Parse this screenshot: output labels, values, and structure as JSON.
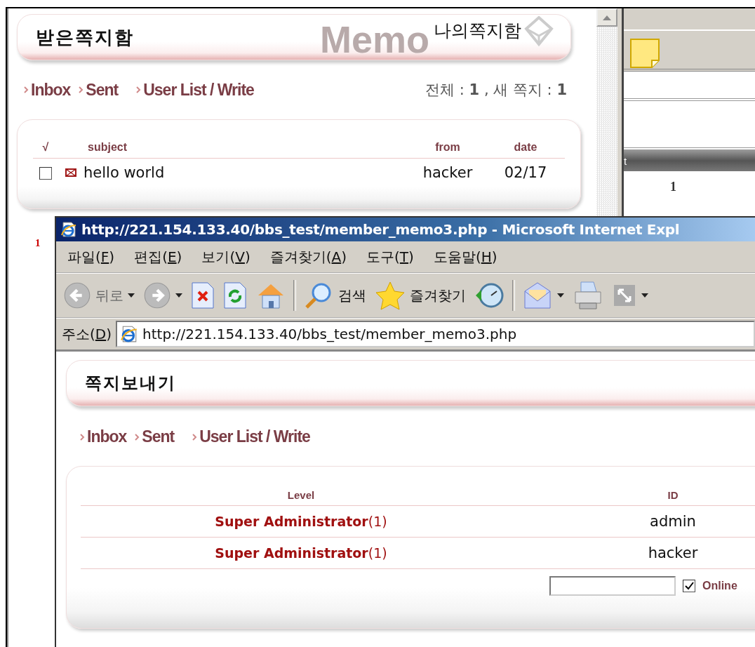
{
  "back_window": {
    "header": {
      "title": "받은쪽지함",
      "subtitle": "나의쪽지함",
      "watermark": "Memo"
    },
    "nav": [
      {
        "label": "Inbox"
      },
      {
        "label": "Sent"
      },
      {
        "label": "User List / Write"
      }
    ],
    "count_text": "전체 : **1** , 새 쪽지 : **1**",
    "inbox_table": {
      "columns": [
        "√",
        "subject",
        "from",
        "date"
      ],
      "rows": [
        {
          "checked": false,
          "subject": "hello world",
          "from": "hacker",
          "date": "02/17"
        }
      ]
    },
    "row_marker": "1",
    "side_panel": {
      "header_fragment": "t",
      "cell": "1"
    }
  },
  "ie_window": {
    "title": "http://221.154.133.40/bbs_test/member_memo3.php - Microsoft Internet Expl",
    "menu": [
      {
        "text": "파일(",
        "key": "F",
        "end": ")"
      },
      {
        "text": "편집(",
        "key": "E",
        "end": ")"
      },
      {
        "text": "보기(",
        "key": "V",
        "end": ")"
      },
      {
        "text": "즐겨찾기(",
        "key": "A",
        "end": ")"
      },
      {
        "text": "도구(",
        "key": "T",
        "end": ")"
      },
      {
        "text": "도움말(",
        "key": "H",
        "end": ")"
      }
    ],
    "toolbar": [
      {
        "kind": "back",
        "label": "뒤로",
        "disabled": true,
        "dropdown": true
      },
      {
        "kind": "forward",
        "disabled": true,
        "dropdown": true
      },
      {
        "kind": "stop",
        "disabled": false,
        "dropdown": false
      },
      {
        "kind": "refresh",
        "disabled": false,
        "dropdown": false
      },
      {
        "kind": "home",
        "disabled": false,
        "dropdown": false
      },
      {
        "kind": "separator"
      },
      {
        "kind": "search",
        "label": "검색",
        "disabled": false,
        "dropdown": false
      },
      {
        "kind": "favorites",
        "label": "즐겨찾기",
        "disabled": false,
        "dropdown": false
      },
      {
        "kind": "history",
        "disabled": false,
        "dropdown": false
      },
      {
        "kind": "separator"
      },
      {
        "kind": "mail",
        "disabled": false,
        "dropdown": true
      },
      {
        "kind": "print",
        "disabled": false,
        "dropdown": false
      },
      {
        "kind": "fullscreen",
        "disabled": true,
        "dropdown": true
      }
    ],
    "address": {
      "text": "주소(",
      "key": "D",
      "end": ")",
      "url": "http://221.154.133.40/bbs_test/member_memo3.php"
    },
    "page": {
      "title": "쪽지보내기",
      "nav": [
        {
          "label": "Inbox"
        },
        {
          "label": "Sent"
        },
        {
          "label": "User List / Write"
        }
      ],
      "user_table": {
        "columns": [
          "Level",
          "ID"
        ],
        "rows": [
          {
            "level": "**Super Administrator**(1)",
            "id": "admin"
          },
          {
            "level": "**Super Administrator**(1)",
            "id": "hacker"
          }
        ]
      },
      "online": {
        "label": "Online",
        "checked": true
      }
    }
  }
}
